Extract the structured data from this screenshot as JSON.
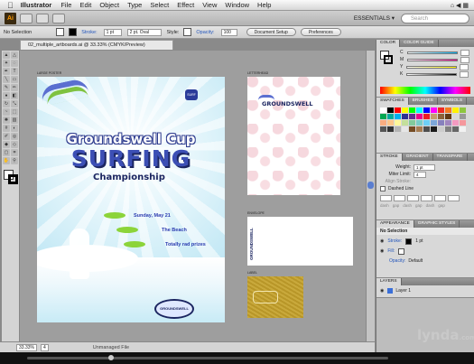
{
  "menubar": {
    "app_name": "Illustrator",
    "items": [
      "File",
      "Edit",
      "Object",
      "Type",
      "Select",
      "Effect",
      "View",
      "Window",
      "Help"
    ],
    "right_text": "⌂ ◀ ▦"
  },
  "appbar": {
    "logo": "Ai",
    "workspace": "ESSENTIALS ▾",
    "search_placeholder": "Search"
  },
  "controlbar": {
    "selection": "No Selection",
    "stroke_label": "Stroke:",
    "stroke_value": "1 pt",
    "brush_value": "2 pt. Oval",
    "style_label": "Style:",
    "opacity_label": "Opacity:",
    "opacity_value": "100",
    "doc_setup": "Document Setup",
    "preferences": "Preferences"
  },
  "doc_tab": "02_multiple_artboards.ai @ 33.33% (CMYK/Preview)",
  "artboards": {
    "poster_label": "LARGE POSTER",
    "letterhead_label": "LETTERHEAD",
    "envelope_label": "ENVELOPE",
    "label_label": "LABEL"
  },
  "poster": {
    "line1": "Groundswell Cup",
    "line2": "SURFING",
    "line3": "Championship",
    "event1": "Sunday, May 21",
    "event2": "The Beach",
    "event3": "Totally rad prizes",
    "badge": "SURF",
    "logo": "GROUNDSWELL"
  },
  "letterhead": {
    "logo": "GROUNDSWELL"
  },
  "envelope": {
    "logo": "GROUNDSWELL"
  },
  "statusbar": {
    "zoom": "33.33%",
    "artboard": "4",
    "file_status": "Unmanaged File"
  },
  "panels": {
    "color_tabs": [
      "COLOR",
      "COLOR GUIDE"
    ],
    "color_rows": [
      "C",
      "M",
      "Y",
      "K"
    ],
    "swatch_tabs": [
      "SWATCHES",
      "BRUSHES",
      "SYMBOLS"
    ],
    "stroke_tabs": [
      "STROKE",
      "GRADIENT",
      "TRANSPARE"
    ],
    "weight_label": "Weight:",
    "weight_value": "1 pt",
    "miter_label": "Miter Limit:",
    "miter_value": "4",
    "align_label": "Align Stroke:",
    "dashed_label": "Dashed Line",
    "dash_headers": [
      "dash",
      "gap",
      "dash",
      "gap",
      "dash",
      "gap"
    ],
    "appearance_tabs": [
      "APPEARANCE",
      "GRAPHIC STYLES"
    ],
    "appearance_title": "No Selection",
    "stroke_row": "Stroke:",
    "stroke_row_value": "1 pt",
    "fill_row": "Fill:",
    "opacity_row": "Opacity:",
    "opacity_row_value": "Default",
    "layers_tab": "LAYERS",
    "layer_name": "Layer 1"
  },
  "watermark": {
    "brand": "lynda",
    "suffix": ".com"
  },
  "colors": {
    "accent_blue": "#2b3bb0",
    "green": "#8cd43a",
    "sky": "#a9def0"
  }
}
